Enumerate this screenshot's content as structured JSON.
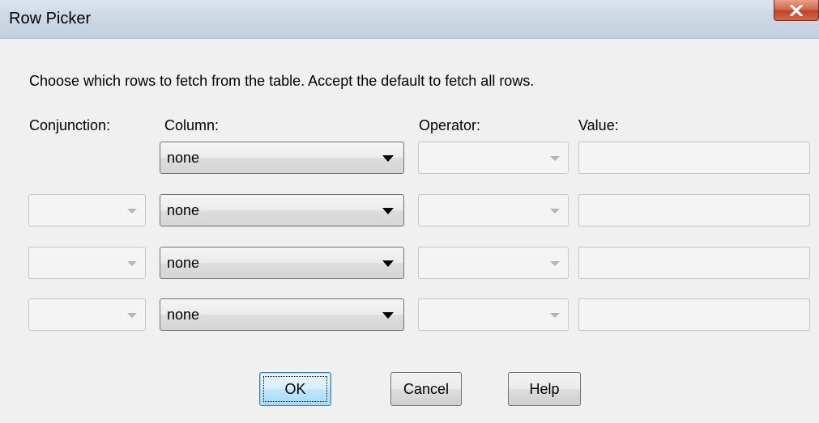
{
  "window": {
    "title": "Row Picker"
  },
  "instruction": "Choose which rows to fetch from the table.  Accept the default to fetch all rows.",
  "columns": {
    "conjunction": "Conjunction:",
    "column": "Column:",
    "operator": "Operator:",
    "value": "Value:"
  },
  "rows": [
    {
      "conjunction": "",
      "column": "none",
      "operator": "",
      "value": ""
    },
    {
      "conjunction": "",
      "column": "none",
      "operator": "",
      "value": ""
    },
    {
      "conjunction": "",
      "column": "none",
      "operator": "",
      "value": ""
    },
    {
      "conjunction": "",
      "column": "none",
      "operator": "",
      "value": ""
    }
  ],
  "buttons": {
    "ok": "OK",
    "cancel": "Cancel",
    "help": "Help"
  },
  "icons": {
    "close": "close-icon",
    "dropdown": "chevron-down-icon"
  },
  "colors": {
    "close_button": "#c0432a",
    "default_button_border": "#3c7fb1"
  }
}
